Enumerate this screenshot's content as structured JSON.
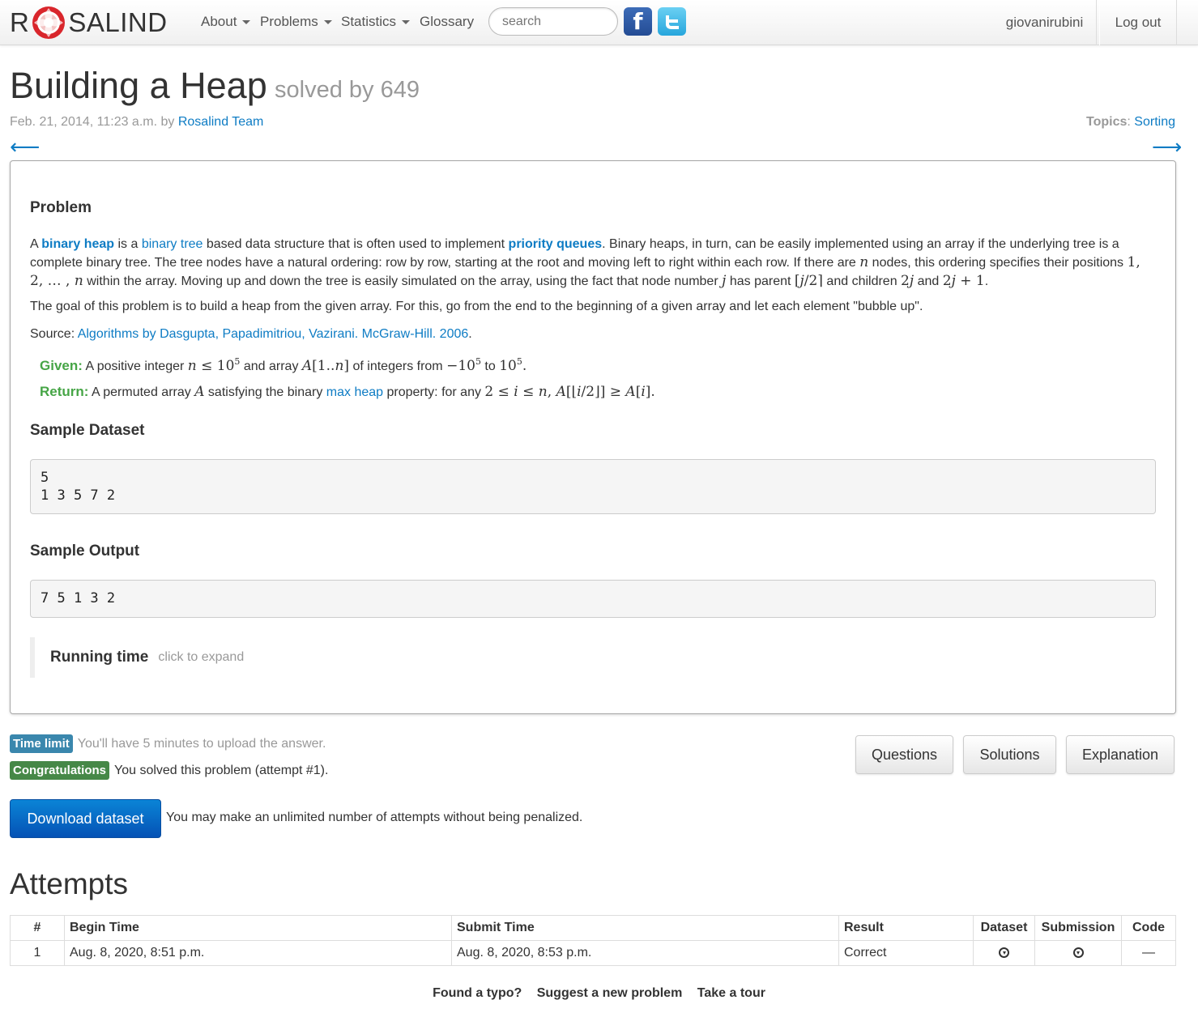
{
  "nav": {
    "brand_left": "R",
    "brand_right": "SALIND",
    "items": [
      {
        "label": "About"
      },
      {
        "label": "Problems"
      },
      {
        "label": "Statistics"
      },
      {
        "label": "Glossary"
      }
    ],
    "search_placeholder": "search",
    "user": "giovanirubini",
    "logout": "Log out"
  },
  "header": {
    "title": "Building a Heap",
    "solved_by": "solved by 649",
    "date": "Feb. 21, 2014, 11:23 a.m. by",
    "author": "Rosalind Team",
    "topics_label": "Topics",
    "topic": "Sorting"
  },
  "problem": {
    "heading": "Problem",
    "source_label": "Source:",
    "source_text": "Algorithms by Dasgupta, Papadimitriou, Vazirani. McGraw-Hill. 2006",
    "given_label": "Given:",
    "return_label": "Return:",
    "sample_dataset_heading": "Sample Dataset",
    "sample_dataset": "5\n1 3 5 7 2",
    "sample_output_heading": "Sample Output",
    "sample_output": "7 5 1 3 2",
    "running_time": "Running time",
    "click_expand": "click to expand"
  },
  "status": {
    "time_limit_label": "Time limit",
    "time_limit_text": "You'll have 5 minutes to upload the answer.",
    "congrats_label": "Congratulations",
    "congrats_text": "You solved this problem (attempt #1).",
    "buttons": [
      "Questions",
      "Solutions",
      "Explanation"
    ],
    "download": "Download dataset",
    "attempts_note": "You may make an unlimited number of attempts without being penalized."
  },
  "colors": {
    "link": "#0e7cc4",
    "time_limit_bg": "#3a87ad",
    "congrats_bg": "#468847",
    "primary": "#0552b5"
  },
  "attempts": {
    "heading": "Attempts",
    "columns": [
      "#",
      "Begin Time",
      "Submit Time",
      "Result",
      "Dataset",
      "Submission",
      "Code"
    ],
    "rows": [
      {
        "n": "1",
        "begin": "Aug. 8, 2020, 8:51 p.m.",
        "submit": "Aug. 8, 2020, 8:53 p.m.",
        "result": "Correct",
        "dataset_icon": "download-circle-icon",
        "submission_icon": "download-circle-icon",
        "code": "—"
      }
    ]
  },
  "footer": {
    "links": [
      "Found a typo?",
      "Suggest a new problem",
      "Take a tour"
    ]
  }
}
